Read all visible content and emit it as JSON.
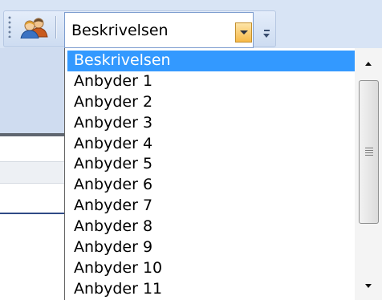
{
  "toolbar": {
    "icon": "users-icon",
    "overflow_icon": "chevron-down-icon"
  },
  "combo": {
    "selected_value": "Beskrivelsen"
  },
  "dropdown": {
    "items": [
      {
        "label": "Beskrivelsen",
        "selected": true
      },
      {
        "label": "Anbyder 1"
      },
      {
        "label": "Anbyder 2"
      },
      {
        "label": "Anbyder 3"
      },
      {
        "label": "Anbyder 4"
      },
      {
        "label": "Anbyder 5"
      },
      {
        "label": "Anbyder 6"
      },
      {
        "label": "Anbyder 7"
      },
      {
        "label": "Anbyder 8"
      },
      {
        "label": "Anbyder 9"
      },
      {
        "label": "Anbyder 10"
      },
      {
        "label": "Anbyder 11"
      }
    ]
  },
  "colors": {
    "selection": "#3399ff",
    "combo_button": "#f7b948",
    "ribbon": "#d8e4f5"
  }
}
